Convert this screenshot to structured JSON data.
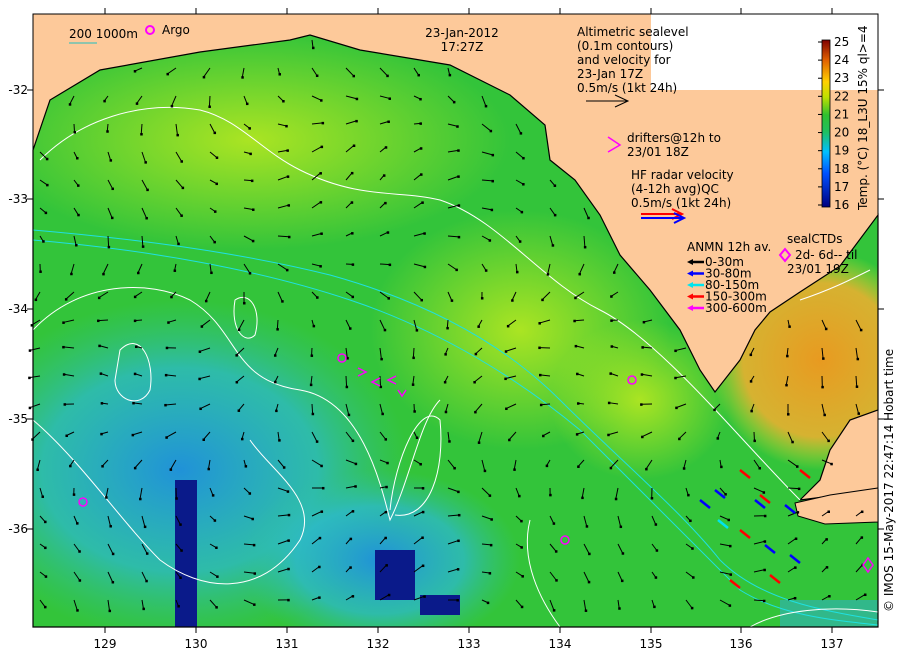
{
  "header": {
    "date": "23-Jan-2012",
    "time": "17:27Z"
  },
  "bathy_legend": {
    "depths": "200  1000m",
    "argo_label": "Argo"
  },
  "altimetry_legend": {
    "lines": [
      "Altimetric sealevel",
      "(0.1m contours)",
      "and velocity for",
      "23-Jan 17Z",
      "0.5m/s (1kt 24h)"
    ]
  },
  "drifters_legend": {
    "lines": [
      "drifters@12h to",
      "23/01 18Z"
    ]
  },
  "hf_radar_legend": {
    "lines": [
      "HF radar velocity",
      "(4-12h avg)QC",
      "0.5m/s (1kt 24h)"
    ]
  },
  "anmn_legend": {
    "title": "ANMN 12h av.",
    "items": [
      {
        "label": "0-30m",
        "color": "#000000"
      },
      {
        "label": "30-80m",
        "color": "#0000ff"
      },
      {
        "label": "80-150m",
        "color": "#00e5ee"
      },
      {
        "label": "150-300m",
        "color": "#ff0000"
      },
      {
        "label": "300-600m",
        "color": "#ff00ff"
      }
    ]
  },
  "seal_legend": {
    "title": "sealCTDs",
    "line1": "2d- 6d-- til",
    "line2": "23/01 19Z"
  },
  "colorbar": {
    "title": "Temp. (°C) 18_L3U 15% ql>=4",
    "ticks": [
      "25",
      "24",
      "23",
      "22",
      "21",
      "20",
      "19",
      "18",
      "17",
      "16"
    ],
    "min": 16,
    "max": 25
  },
  "axes": {
    "x_ticks": [
      "129",
      "130",
      "131",
      "132",
      "133",
      "134",
      "135",
      "136",
      "137"
    ],
    "y_ticks": [
      "-32",
      "-33",
      "-34",
      "-35",
      "-36"
    ]
  },
  "credit": "© IMOS 15-May-2017 22:47:14 Hobart time",
  "colors": {
    "land": "#fdc99a",
    "sea_green": "#33c43a",
    "argo": "#ff00ff"
  }
}
